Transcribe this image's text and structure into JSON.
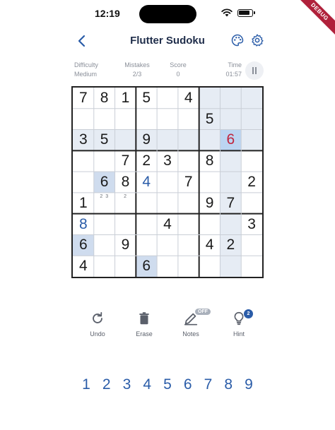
{
  "status_bar": {
    "time": "12:19",
    "debug_label": "DEBUG"
  },
  "app_bar": {
    "title": "Flutter Sudoku"
  },
  "stats": {
    "difficulty_label": "Difficulty",
    "difficulty": "Medium",
    "mistakes_label": "Mistakes",
    "mistakes": "2/3",
    "score_label": "Score",
    "score": "0",
    "time_label": "Time",
    "time": "01:57"
  },
  "board": {
    "rows": [
      [
        "7",
        "8",
        "1",
        "5",
        "",
        "4",
        "",
        "",
        ""
      ],
      [
        "",
        "",
        "",
        "",
        "",
        "",
        "5",
        "",
        ""
      ],
      [
        "3",
        "5",
        "",
        "9",
        "",
        "",
        "",
        "6",
        ""
      ],
      [
        "",
        "",
        "7",
        "2",
        "3",
        "",
        "8",
        "",
        ""
      ],
      [
        "",
        "6",
        "8",
        "4",
        "",
        "7",
        "",
        "",
        "2"
      ],
      [
        "1",
        "",
        "",
        "",
        "",
        "",
        "9",
        "7",
        ""
      ],
      [
        "8",
        "",
        "",
        "",
        "4",
        "",
        "",
        "",
        "3"
      ],
      [
        "6",
        "",
        "9",
        "",
        "",
        "",
        "4",
        "2",
        ""
      ],
      [
        "4",
        "",
        "",
        "6",
        "",
        "",
        "",
        "",
        ""
      ]
    ],
    "notes": {
      "5-1": "2 3",
      "5-2": "2"
    },
    "user_entries": [
      "4-3",
      "6-0"
    ],
    "error_entries": [
      "2-7"
    ],
    "selected": "2-7",
    "same_number_cells": [
      "4-1",
      "7-0",
      "8-3"
    ],
    "colors": {
      "highlight": "#e6ecf4",
      "selected": "#bcd5f2",
      "user": "#2a5ca8",
      "error": "#c0253e"
    }
  },
  "tools": {
    "undo_label": "Undo",
    "erase_label": "Erase",
    "notes_label": "Notes",
    "notes_state": "OFF",
    "hint_label": "Hint",
    "hint_count": "2"
  },
  "numpad": [
    "1",
    "2",
    "3",
    "4",
    "5",
    "6",
    "7",
    "8",
    "9"
  ]
}
